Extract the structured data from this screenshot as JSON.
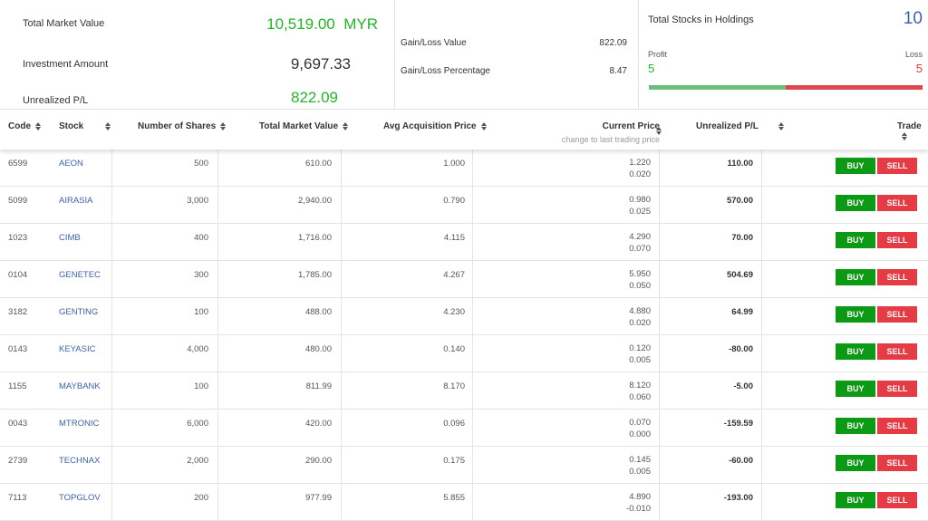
{
  "summary": {
    "total_market_value_label": "Total Market Value",
    "total_market_value": "10,519.00",
    "currency": "MYR",
    "investment_amount_label": "Investment Amount",
    "investment_amount": "9,697.33",
    "unrealized_pl_label": "Unrealized P/L",
    "unrealized_pl": "822.09",
    "gain_loss_value_label": "Gain/Loss Value",
    "gain_loss_value": "822.09",
    "gain_loss_pct_label": "Gain/Loss Percentage",
    "gain_loss_pct": "8.47",
    "total_stocks_label": "Total Stocks in Holdings",
    "total_stocks": "10",
    "profit_label": "Profit",
    "profit_count": "5",
    "loss_label": "Loss",
    "loss_count": "5",
    "profit_ratio": 0.5
  },
  "colors": {
    "positive": "#22b527",
    "negative": "#e53935",
    "accent": "#3d62a8",
    "buy": "#0c9a14",
    "sell": "#e53b45",
    "bar_profit": "#6abf7b",
    "bar_loss": "#e0464e"
  },
  "table": {
    "headers": {
      "code": "Code",
      "stock": "Stock",
      "shares": "Number of Shares",
      "market_value": "Total Market Value",
      "avg_price": "Avg Acquisition Price",
      "current_price": "Current Price",
      "current_price_sub": "change to last trading price",
      "unrealized": "Unrealized P/L",
      "trade": "Trade"
    },
    "buy_label": "BUY",
    "sell_label": "SELL",
    "rows": [
      {
        "code": "6599",
        "stock": "AEON",
        "shares": "500",
        "market_value": "610.00",
        "avg_price": "1.000",
        "current_price": "1.220",
        "change": "0.020",
        "unrealized": "110.00"
      },
      {
        "code": "5099",
        "stock": "AIRASIA",
        "shares": "3,000",
        "market_value": "2,940.00",
        "avg_price": "0.790",
        "current_price": "0.980",
        "change": "0.025",
        "unrealized": "570.00"
      },
      {
        "code": "1023",
        "stock": "CIMB",
        "shares": "400",
        "market_value": "1,716.00",
        "avg_price": "4.115",
        "current_price": "4.290",
        "change": "0.070",
        "unrealized": "70.00"
      },
      {
        "code": "0104",
        "stock": "GENETEC",
        "shares": "300",
        "market_value": "1,785.00",
        "avg_price": "4.267",
        "current_price": "5.950",
        "change": "0.050",
        "unrealized": "504.69"
      },
      {
        "code": "3182",
        "stock": "GENTING",
        "shares": "100",
        "market_value": "488.00",
        "avg_price": "4.230",
        "current_price": "4.880",
        "change": "0.020",
        "unrealized": "64.99"
      },
      {
        "code": "0143",
        "stock": "KEYASIC",
        "shares": "4,000",
        "market_value": "480.00",
        "avg_price": "0.140",
        "current_price": "0.120",
        "change": "0.005",
        "unrealized": "-80.00"
      },
      {
        "code": "1155",
        "stock": "MAYBANK",
        "shares": "100",
        "market_value": "811.99",
        "avg_price": "8.170",
        "current_price": "8.120",
        "change": "0.060",
        "unrealized": "-5.00"
      },
      {
        "code": "0043",
        "stock": "MTRONIC",
        "shares": "6,000",
        "market_value": "420.00",
        "avg_price": "0.096",
        "current_price": "0.070",
        "change": "0.000",
        "unrealized": "-159.59"
      },
      {
        "code": "2739",
        "stock": "TECHNAX",
        "shares": "2,000",
        "market_value": "290.00",
        "avg_price": "0.175",
        "current_price": "0.145",
        "change": "0.005",
        "unrealized": "-60.00"
      },
      {
        "code": "7113",
        "stock": "TOPGLOV",
        "shares": "200",
        "market_value": "977.99",
        "avg_price": "5.855",
        "current_price": "4.890",
        "change": "-0.010",
        "unrealized": "-193.00"
      }
    ]
  }
}
